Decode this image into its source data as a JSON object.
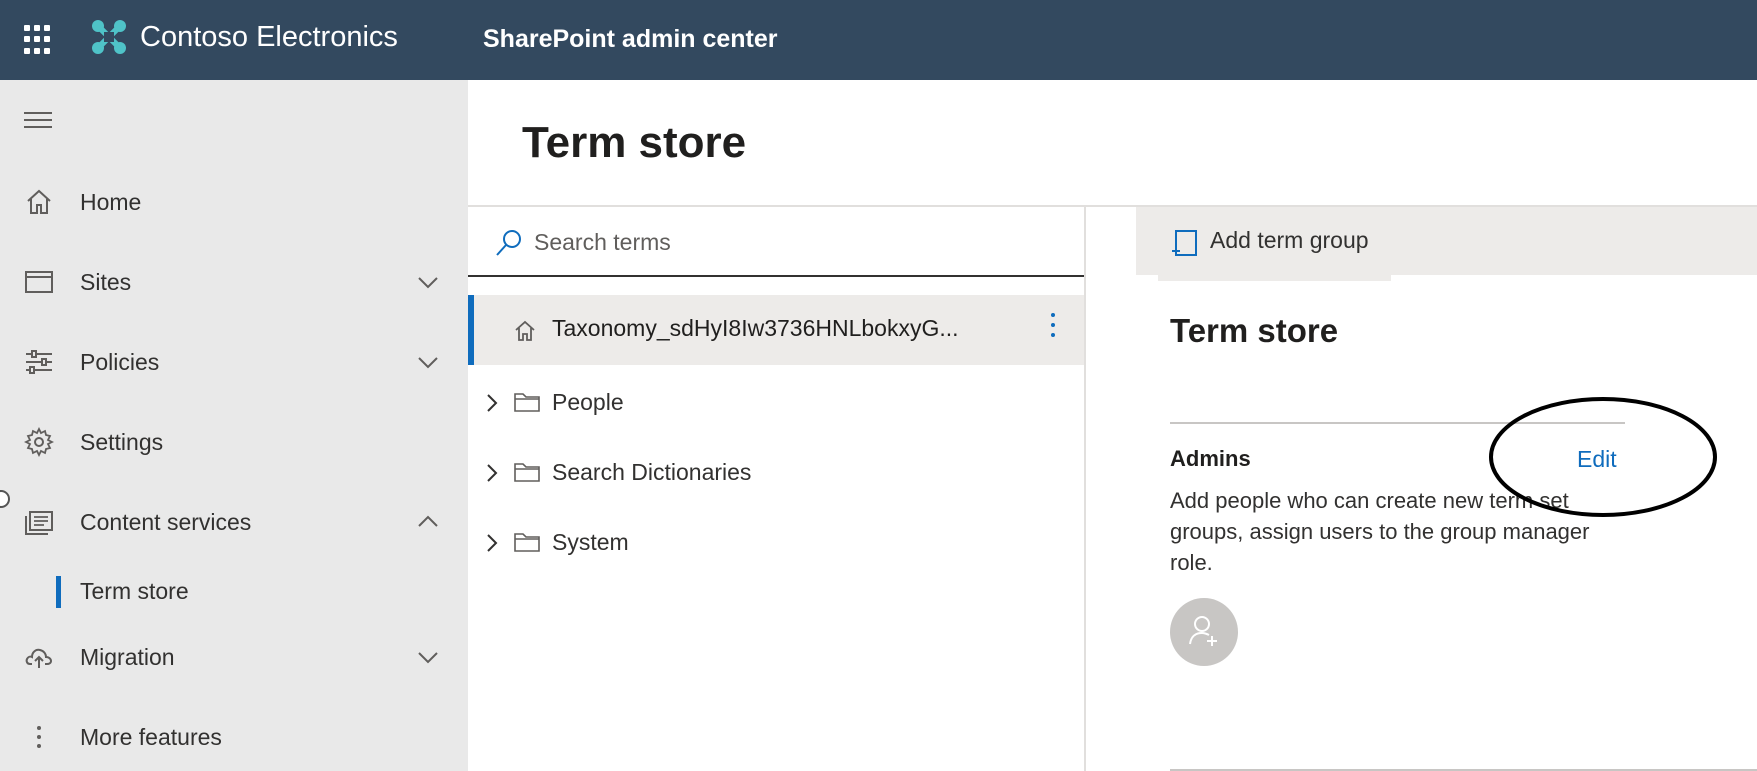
{
  "header": {
    "org_name": "Contoso Electronics",
    "app_name": "SharePoint admin center",
    "bar_color": "#33495f"
  },
  "leftnav": {
    "items": [
      {
        "label": "Home",
        "icon": "home-icon"
      },
      {
        "label": "Sites",
        "icon": "sites-icon",
        "expanded": false
      },
      {
        "label": "Policies",
        "icon": "policies-icon",
        "expanded": false
      },
      {
        "label": "Settings",
        "icon": "gear-icon"
      },
      {
        "label": "Content services",
        "icon": "content-services-icon",
        "expanded": true
      },
      {
        "label": "Migration",
        "icon": "cloud-upload-icon",
        "expanded": false
      },
      {
        "label": "More features",
        "icon": "more-vertical-icon"
      }
    ],
    "subitems": [
      {
        "label": "Term store",
        "selected": true
      }
    ]
  },
  "main": {
    "title": "Term store"
  },
  "tree": {
    "search_placeholder": "Search terms",
    "root": {
      "label": "Taxonomy_sdHyI8Iw3736HNLbokxyG...",
      "icon": "home-icon",
      "selected": true
    },
    "nodes": [
      {
        "label": "People",
        "icon": "folder-icon"
      },
      {
        "label": "Search Dictionaries",
        "icon": "folder-icon"
      },
      {
        "label": "System",
        "icon": "folder-icon"
      }
    ]
  },
  "details": {
    "command": {
      "label": "Add term group",
      "icon": "add-term-group-icon"
    },
    "title": "Term store",
    "admins": {
      "heading": "Admins",
      "edit_label": "Edit",
      "description": "Add people who can create new term set groups, assign users to the group manager role."
    }
  },
  "colors": {
    "accent": "#0f6cbd",
    "nav_bg": "#e9e9e9",
    "selected_bg": "#edebe9"
  }
}
